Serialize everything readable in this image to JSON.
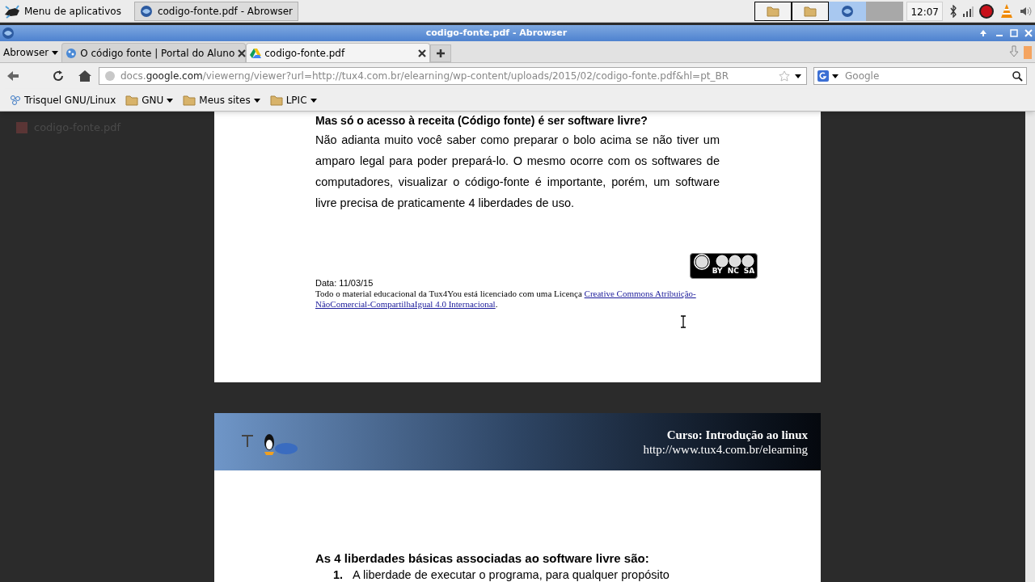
{
  "taskbar": {
    "app_menu": "Menu de aplicativos",
    "window_button": "codigo-fonte.pdf - Abrowser",
    "clock": "12:07",
    "workspaces": [
      {
        "selected": false
      },
      {
        "selected": false
      },
      {
        "selected": true
      },
      {
        "selected": false
      }
    ]
  },
  "window": {
    "title": "codigo-fonte.pdf - Abrowser"
  },
  "app_button": "Abrowser",
  "tabs": [
    {
      "label": "O código fonte | Portal do Aluno",
      "selected": false
    },
    {
      "label": "codigo-fonte.pdf",
      "selected": true
    }
  ],
  "address": {
    "host_pre": "docs.",
    "host": "google.com",
    "rest": "/viewerng/viewer?url=http://tux4.com.br/elearning/wp-content/uploads/2015/02/codigo-fonte.pdf&hl=pt_BR"
  },
  "search": {
    "placeholder": "Google"
  },
  "bookmarks": [
    {
      "kind": "link",
      "label": "Trisquel GNU/Linux"
    },
    {
      "kind": "folder",
      "label": "GNU"
    },
    {
      "kind": "folder",
      "label": "Meus sites"
    },
    {
      "kind": "folder",
      "label": "LPIC"
    }
  ],
  "viewer": {
    "file_name": "codigo-fonte.pdf"
  },
  "page1": {
    "heading": "Mas só o acesso à receita (Código fonte) é ser software livre?",
    "paragraph": "Não adianta muito você saber como preparar o bolo acima se não tiver um amparo legal para poder prepará-lo. O mesmo ocorre com os softwares de computadores, visualizar o código-fonte é importante, porém, um software livre precisa de praticamente 4 liberdades de uso.",
    "date": "Data: 11/03/15",
    "license_text": "Todo o material educacional da Tux4You está licenciado com uma Licença ",
    "license_link": [
      "Creative Commons Atribuição-",
      "NãoComercial-CompartilhaIgual 4.0 Internacional"
    ],
    "license_end": ".",
    "badge_labels": [
      "BY",
      "NC",
      "SA"
    ]
  },
  "page2": {
    "course": "Curso: Introdução ao linux",
    "url": "http://www.tux4.com.br/elearning",
    "heading": "As 4 liberdades básicas associadas ao software livre são:",
    "items": [
      {
        "number": "1.",
        "text": "A liberdade de executar o programa, para qualquer propósito"
      }
    ]
  }
}
